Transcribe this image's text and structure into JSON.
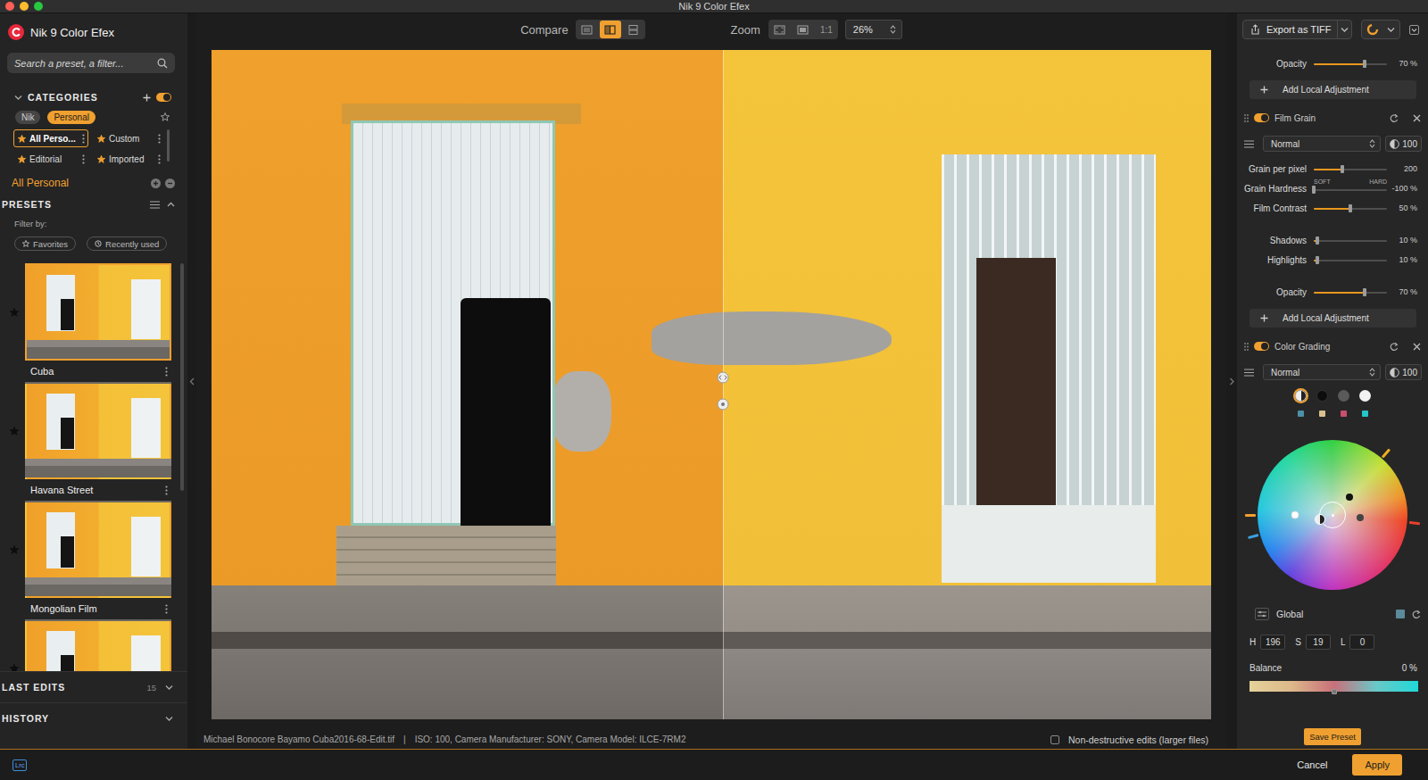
{
  "window": {
    "title": "Nik 9 Color Efex"
  },
  "app": {
    "name": "Nik 9 Color Efex"
  },
  "search": {
    "placeholder": "Search a preset, a filter..."
  },
  "categories": {
    "title": "CATEGORIES",
    "expanded": true,
    "enabled": true,
    "sources": [
      {
        "label": "Nik",
        "selected": false
      },
      {
        "label": "Personal",
        "selected": true
      }
    ],
    "items": [
      {
        "label": "All Perso...",
        "selected": true
      },
      {
        "label": "Custom",
        "selected": false
      },
      {
        "label": "Editorial",
        "selected": false
      },
      {
        "label": "Imported",
        "selected": false
      }
    ]
  },
  "collection": {
    "label": "All Personal"
  },
  "presets": {
    "title": "PRESETS",
    "expanded": true,
    "filter_label": "Filter by:",
    "filters": [
      {
        "label": "Favorites",
        "selected": false
      },
      {
        "label": "Recently used",
        "selected": false
      }
    ],
    "items": [
      {
        "name": "Cuba",
        "selected": true,
        "favorite": true
      },
      {
        "name": "Havana Street",
        "selected": false,
        "favorite": true
      },
      {
        "name": "Mongolian Film",
        "selected": false,
        "favorite": true
      },
      {
        "selected": false,
        "favorite": true
      }
    ]
  },
  "last_edits": {
    "title": "LAST EDITS",
    "count": "15",
    "expanded": false
  },
  "history": {
    "title": "HISTORY",
    "expanded": false
  },
  "toolbar": {
    "compare_label": "Compare",
    "compare_modes": [
      {
        "kind": "single",
        "selected": false
      },
      {
        "kind": "split",
        "selected": true
      },
      {
        "kind": "stacked",
        "selected": false
      }
    ],
    "zoom_label": "Zoom",
    "zoom_modes": [
      {
        "kind": "fit",
        "selected": false
      },
      {
        "kind": "fill",
        "selected": false
      },
      {
        "kind": "actual",
        "label": "1:1",
        "selected": false
      }
    ],
    "zoom_value": "26%"
  },
  "preview": {
    "divider": {
      "level": 0.512
    }
  },
  "status_bar": {
    "filename": "Michael Bonocore Bayamo Cuba2016-68-Edit.tif",
    "separator": "|",
    "metadata": "ISO: 100, Camera Manufacturer: SONY, Camera Model: ILCE-7RM2",
    "nondestructive": {
      "label": "Non-destructive edits (larger files)",
      "checked": false
    }
  },
  "export": {
    "label": "Export as TIFF"
  },
  "filters": [
    {
      "kind": "partial",
      "groups": [
        [
          {
            "label": "Opacity",
            "level": 0.7,
            "reading": "70 %"
          }
        ]
      ],
      "add_label": "Add Local Adjustment"
    },
    {
      "kind": "film-grain",
      "title": "Film Grain",
      "enabled": true,
      "blend": "Normal",
      "opacity": "100",
      "groups": [
        [
          {
            "label": "Grain per pixel",
            "level": 0.39,
            "reading": "200"
          },
          {
            "label": "Grain Hardness",
            "level": 0.0,
            "reading": "-100 %",
            "ends": [
              "SOFT",
              "HARD"
            ]
          },
          {
            "label": "Film Contrast",
            "level": 0.5,
            "reading": "50 %"
          }
        ],
        [
          {
            "label": "Shadows",
            "level": 0.05,
            "reading": "10 %"
          },
          {
            "label": "Highlights",
            "level": 0.05,
            "reading": "10 %"
          }
        ],
        [
          {
            "label": "Opacity",
            "level": 0.7,
            "reading": "70 %"
          }
        ]
      ],
      "add_label": "Add Local Adjustment"
    },
    {
      "kind": "color-grading",
      "title": "Color Grading",
      "enabled": true,
      "blend": "Normal",
      "opacity": "100",
      "tones": [
        {
          "kind": "all",
          "selected": true,
          "color": "#4d8fa6"
        },
        {
          "kind": "shadows",
          "selected": false,
          "color": "#d8c08e"
        },
        {
          "kind": "midtones",
          "selected": false,
          "color": "#c9506d"
        },
        {
          "kind": "highlights",
          "selected": false,
          "color": "#25c4c8"
        }
      ],
      "wheel": {
        "markers": [
          {
            "kind": "highlights",
            "x": 0.25,
            "y": 0.5
          },
          {
            "kind": "shadows",
            "x": 0.616,
            "y": 0.378
          },
          {
            "kind": "midtones",
            "x": 0.683,
            "y": 0.518
          },
          {
            "kind": "all",
            "x": 0.415,
            "y": 0.53
          }
        ],
        "ticks": [
          {
            "angle": 49,
            "color": "#f0b020"
          },
          {
            "angle": -6,
            "color": "#e8402a"
          },
          {
            "angle": 180,
            "color": "#f0a030"
          },
          {
            "angle": 195,
            "color": "#3aa0e0"
          }
        ]
      },
      "scope": "Global",
      "swatch": "#5b8a9b",
      "hsl": [
        {
          "label": "H",
          "value": "196"
        },
        {
          "label": "S",
          "value": "19"
        },
        {
          "label": "L",
          "value": "0"
        }
      ],
      "balance": {
        "label": "Balance",
        "reading": "0 %",
        "level": 0.5
      }
    }
  ],
  "save_preset": "Save Preset",
  "footer": {
    "badge": "Lrc",
    "cancel": "Cancel",
    "apply": "Apply"
  }
}
